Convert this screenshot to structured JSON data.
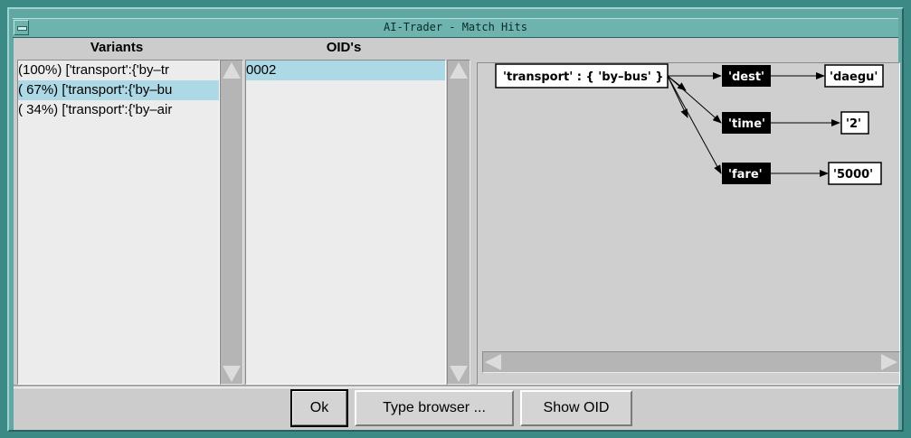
{
  "window": {
    "title": "AI-Trader - Match Hits"
  },
  "variants": {
    "header": "Variants",
    "items": [
      {
        "label": "(100%) ['transport':{'by–tr",
        "selected": false
      },
      {
        "label": "( 67%) ['transport':{'by–bu",
        "selected": true
      },
      {
        "label": "( 34%) ['transport':{'by–air",
        "selected": false
      }
    ]
  },
  "oids": {
    "header": "OID's",
    "items": [
      {
        "label": "0002",
        "selected": true
      }
    ]
  },
  "graph": {
    "root": "'transport' : { 'by–bus' }",
    "attributes": [
      {
        "name": "'dest'",
        "value": "'daegu'"
      },
      {
        "name": "'time'",
        "value": "'2'"
      },
      {
        "name": "'fare'",
        "value": "'5000'"
      }
    ]
  },
  "buttons": {
    "ok": "Ok",
    "type_browser": "Type browser ...",
    "show_oid": "Show OID"
  },
  "colors": {
    "frame": "#3c8a85",
    "titlebar": "#6fb3ae",
    "selection": "#add8e6",
    "panel": "#cccccc"
  }
}
